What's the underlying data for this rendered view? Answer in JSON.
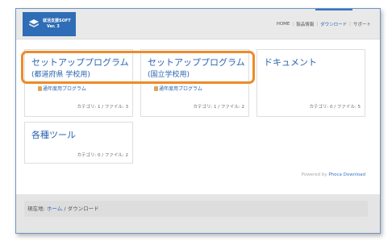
{
  "logo": {
    "name": "就活支援SOFT",
    "version": "Ver. 3"
  },
  "nav": {
    "items": [
      {
        "label": "HOME",
        "active": false
      },
      {
        "label": "製品情報",
        "active": false
      },
      {
        "label": "ダウンロード",
        "active": true
      },
      {
        "label": "サポート",
        "active": false
      }
    ],
    "separator": "|"
  },
  "categories": [
    {
      "title": "セットアッププログラム",
      "subtitle": "(都道府県 学校用)",
      "link": "通年度用プログラム",
      "count": "カテゴリ: 1 / ファイル: 3"
    },
    {
      "title": "セットアッププログラム",
      "subtitle": "(国立学校用)",
      "link": "通年度用プログラム",
      "count": "カテゴリ: 1 / ファイル: 2"
    },
    {
      "title": "ドキュメント",
      "subtitle": "",
      "link": "",
      "count": "カテゴリ: 0 / ファイル: 5"
    },
    {
      "title": "各種ツール",
      "subtitle": "",
      "link": "",
      "count": "カテゴリ: 0 / ファイル: 2"
    }
  ],
  "powered": {
    "prefix": "Powered by",
    "link": "Phoca Download"
  },
  "breadcrumb": {
    "label": "現在地:",
    "home": "ホーム",
    "separator": "/",
    "current": "ダウンロード"
  },
  "colors": {
    "accent": "#2f6db6",
    "highlight": "#ec8b2a",
    "link": "#2a64b0"
  }
}
